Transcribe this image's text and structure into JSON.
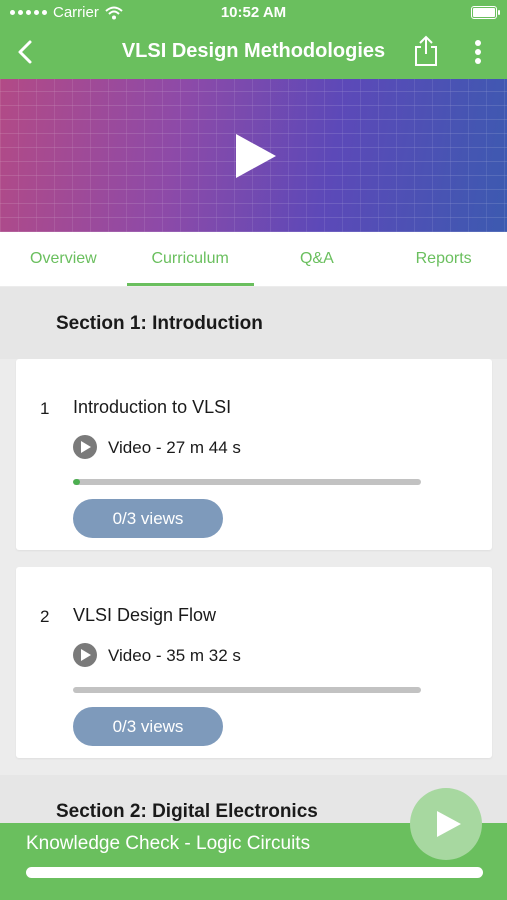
{
  "status_bar": {
    "carrier": "Carrier",
    "time": "10:52 AM"
  },
  "nav": {
    "title": "VLSI Design Methodologies",
    "back_icon": "chevron-left-icon",
    "share_icon": "share-icon",
    "more_icon": "more-vertical-icon"
  },
  "banner": {
    "play_icon": "play-icon"
  },
  "tabs": [
    {
      "label": "Overview",
      "active": false
    },
    {
      "label": "Curriculum",
      "active": true
    },
    {
      "label": "Q&A",
      "active": false
    },
    {
      "label": "Reports",
      "active": false
    }
  ],
  "sections": [
    {
      "title": "Section 1: Introduction",
      "lectures": [
        {
          "number": "1",
          "title": "Introduction to VLSI",
          "type": "Video - 27 m 44 s",
          "progress": 0.02,
          "views": "0/3 views"
        },
        {
          "number": "2",
          "title": "VLSI Design Flow",
          "type": "Video - 35 m 32 s",
          "progress": 0,
          "views": "0/3 views"
        }
      ]
    },
    {
      "title": "Section 2: Digital Electronics"
    }
  ],
  "bottom_bar": {
    "label": "Knowledge Check - Logic Circuits",
    "progress": 1.0,
    "play_icon": "play-icon"
  },
  "colors": {
    "primary": "#6abf5e",
    "views_button": "#7e9abb",
    "progress_fill": "#4caf50"
  }
}
